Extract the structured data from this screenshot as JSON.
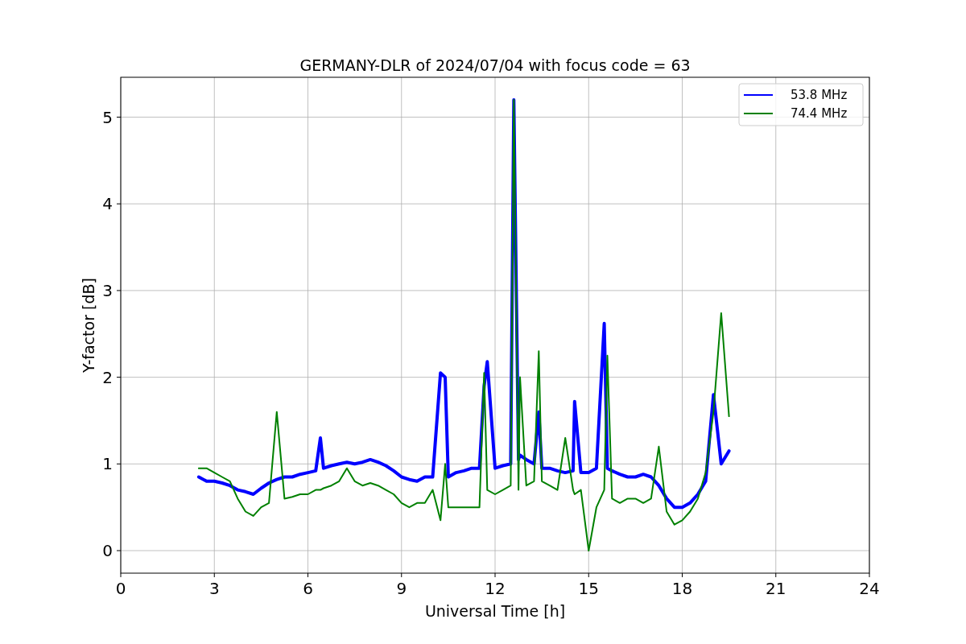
{
  "chart_data": {
    "type": "line",
    "title": "GERMANY-DLR of 2024/07/04 with focus code = 63",
    "xlabel": "Universal Time [h]",
    "ylabel": "Y-factor [dB]",
    "x": [
      2.5,
      2.75,
      3,
      3.25,
      3.5,
      3.75,
      4,
      4.25,
      4.5,
      4.75,
      5,
      5.25,
      5.5,
      5.75,
      6,
      6.25,
      6.4,
      6.5,
      6.75,
      7,
      7.25,
      7.5,
      7.75,
      8,
      8.25,
      8.5,
      8.75,
      9,
      9.25,
      9.5,
      9.75,
      10,
      10.25,
      10.4,
      10.5,
      10.75,
      11,
      11.25,
      11.5,
      11.65,
      11.75,
      12,
      12.25,
      12.5,
      12.6,
      12.75,
      12.8,
      13,
      13.25,
      13.4,
      13.5,
      13.75,
      14,
      14.25,
      14.5,
      14.55,
      14.75,
      15,
      15.25,
      15.5,
      15.6,
      15.75,
      16,
      16.25,
      16.5,
      16.75,
      17,
      17.25,
      17.5,
      17.75,
      18,
      18.25,
      18.5,
      18.75,
      19,
      19.25,
      19.5
    ],
    "series": [
      {
        "name": "53.8 MHz",
        "color": "#0000ff",
        "values": [
          0.85,
          0.8,
          0.8,
          0.78,
          0.75,
          0.7,
          0.68,
          0.65,
          0.72,
          0.78,
          0.82,
          0.85,
          0.85,
          0.88,
          0.9,
          0.92,
          1.3,
          0.95,
          0.98,
          1.0,
          1.02,
          1.0,
          1.02,
          1.05,
          1.02,
          0.98,
          0.92,
          0.85,
          0.82,
          0.8,
          0.85,
          0.85,
          2.05,
          2.0,
          0.85,
          0.9,
          0.92,
          0.95,
          0.95,
          1.9,
          2.18,
          0.95,
          0.98,
          1.0,
          5.2,
          1.05,
          1.1,
          1.05,
          1.0,
          1.6,
          0.95,
          0.95,
          0.92,
          0.9,
          0.92,
          1.72,
          0.9,
          0.9,
          0.95,
          2.62,
          0.95,
          0.92,
          0.88,
          0.85,
          0.85,
          0.88,
          0.85,
          0.75,
          0.6,
          0.5,
          0.5,
          0.55,
          0.65,
          0.8,
          1.8,
          1.0,
          1.15
        ]
      },
      {
        "name": "74.4 MHz",
        "color": "#008000",
        "values": [
          0.95,
          0.95,
          0.9,
          0.85,
          0.8,
          0.6,
          0.45,
          0.4,
          0.5,
          0.55,
          1.6,
          0.6,
          0.62,
          0.65,
          0.65,
          0.7,
          0.7,
          0.72,
          0.75,
          0.8,
          0.95,
          0.8,
          0.75,
          0.78,
          0.75,
          0.7,
          0.65,
          0.55,
          0.5,
          0.55,
          0.55,
          0.7,
          0.35,
          1.0,
          0.5,
          0.5,
          0.5,
          0.5,
          0.5,
          2.05,
          0.7,
          0.65,
          0.7,
          0.75,
          5.2,
          0.7,
          2.0,
          0.75,
          0.8,
          2.3,
          0.8,
          0.75,
          0.7,
          1.3,
          0.7,
          0.65,
          0.7,
          0.0,
          0.5,
          0.7,
          2.25,
          0.6,
          0.55,
          0.6,
          0.6,
          0.55,
          0.6,
          1.2,
          0.45,
          0.3,
          0.35,
          0.45,
          0.6,
          0.9,
          1.6,
          2.74,
          1.55
        ]
      }
    ],
    "grid": true,
    "legend": true,
    "xlim": [
      0,
      24
    ],
    "ylim": [
      -0.26,
      5.46
    ],
    "xticks": [
      0,
      3,
      6,
      9,
      12,
      15,
      18,
      21,
      24
    ],
    "yticks": [
      0,
      1,
      2,
      3,
      4,
      5
    ]
  }
}
